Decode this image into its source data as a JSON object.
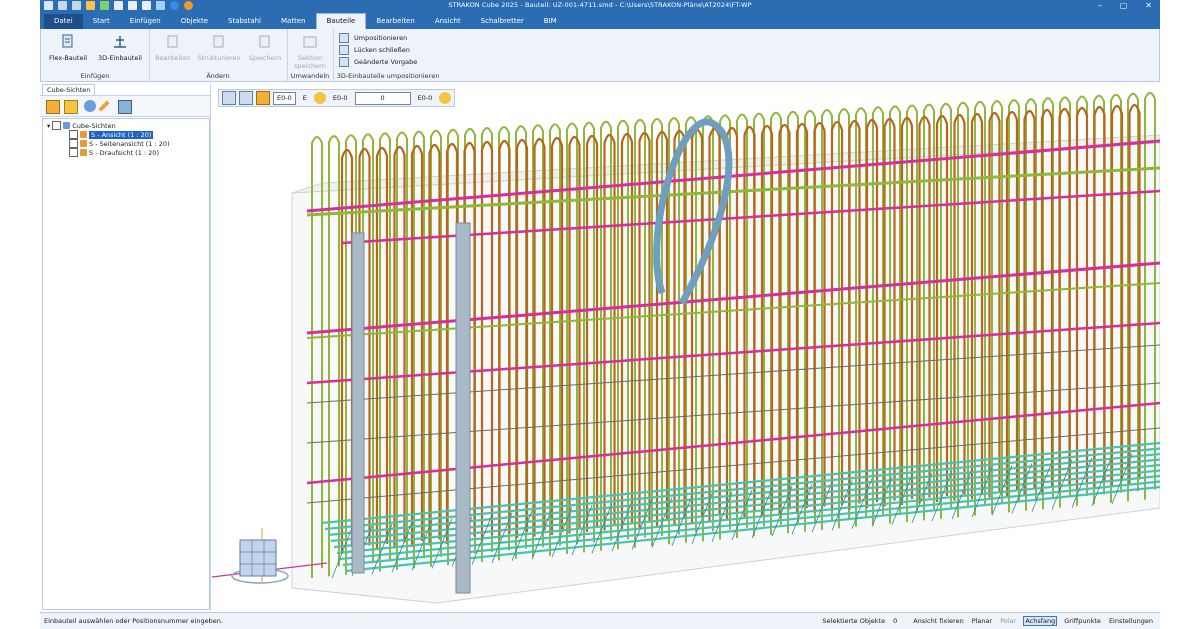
{
  "window": {
    "title": "STRAKON Cube 2025 - Bauteil: UZ-001-4711.smd - C:\\Users\\STRAKON-Pläne\\AT2024\\FT-WP",
    "controls": [
      "–",
      "▢",
      "✕"
    ]
  },
  "menu": {
    "tabs": [
      "Datei",
      "Start",
      "Einfügen",
      "Objekte",
      "Stabstahl",
      "Matten",
      "Bauteile",
      "Bearbeiten",
      "Ansicht",
      "Schalbretter",
      "BIM"
    ],
    "active": "Bauteile"
  },
  "ribbon": {
    "groups": [
      {
        "label": "Einfügen",
        "buttons": [
          "Flex-Bauteil",
          "3D-Einbauteil"
        ]
      },
      {
        "label": "Ändern",
        "buttons": [
          "Bearbeiten",
          "Strukturieren",
          "Speichern"
        ]
      },
      {
        "label": "Umwandeln",
        "buttons": [
          "Sektion speichern"
        ]
      },
      {
        "label": "3D-Einbauteile umpositionieren",
        "buttons": [
          "Umpositionieren",
          "Lücken schließen",
          "Geänderte Vorgabe"
        ]
      }
    ]
  },
  "left_panel": {
    "tab": "Cube-Sichten",
    "tree": {
      "root": "Cube-Sichten",
      "items": [
        "S - Ansicht (1 : 20)",
        "S - Seitenansicht (1 : 20)",
        "S - Draufsicht (1 : 20)"
      ],
      "selected": "S - Ansicht (1 : 20)"
    }
  },
  "viewport_toolbar": {
    "field_1": "E0-0",
    "field_2": "E",
    "field_3": "E0-0",
    "input": "0",
    "field_4": "E0-0"
  },
  "status": {
    "prompt": "Einbauteil auswählen oder Positionsnummer eingeben.",
    "selected_label": "Selektierte Objekte",
    "selected_count": "0",
    "toggles": [
      "Ansicht fixieren",
      "Planar",
      "Polar",
      "Achsfang",
      "Griffpunkte",
      "Einstellungen"
    ],
    "active_toggle": "Achsfang"
  },
  "colors": {
    "title_bar": "#2b6cb2",
    "ribbon_bg": "#eef3fa",
    "rebar_green": "#8fb83a",
    "rebar_orange": "#b9651c",
    "rebar_magenta": "#d42f9a",
    "rebar_cyan": "#49c2b6",
    "anchor_blue": "#6f9fbf"
  }
}
